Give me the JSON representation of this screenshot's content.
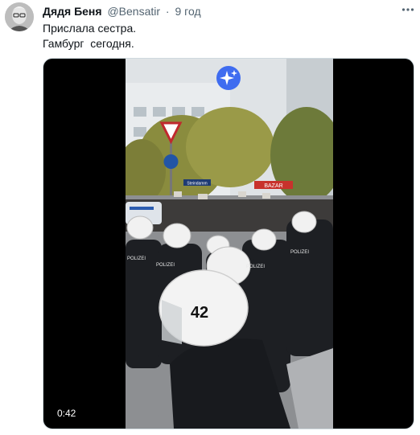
{
  "tweet": {
    "author_name": "Дядя Беня",
    "author_handle": "@Bensatir",
    "separator": "·",
    "time": "9 год",
    "text_lines": [
      "Прислала сестра.",
      "Гамбург  сегодня."
    ],
    "more_icon": "more-dots-icon"
  },
  "media": {
    "duration": "0:42",
    "sparkle_icon": "sparkle-icon",
    "scene_texts": {
      "helmet_number": "42",
      "vest_label": "POLIZEI",
      "street_sign": "Steindamm",
      "shop_sign": "BAZAR"
    }
  },
  "colors": {
    "handle": "#536471",
    "sparkle": "#3f6cf0"
  }
}
